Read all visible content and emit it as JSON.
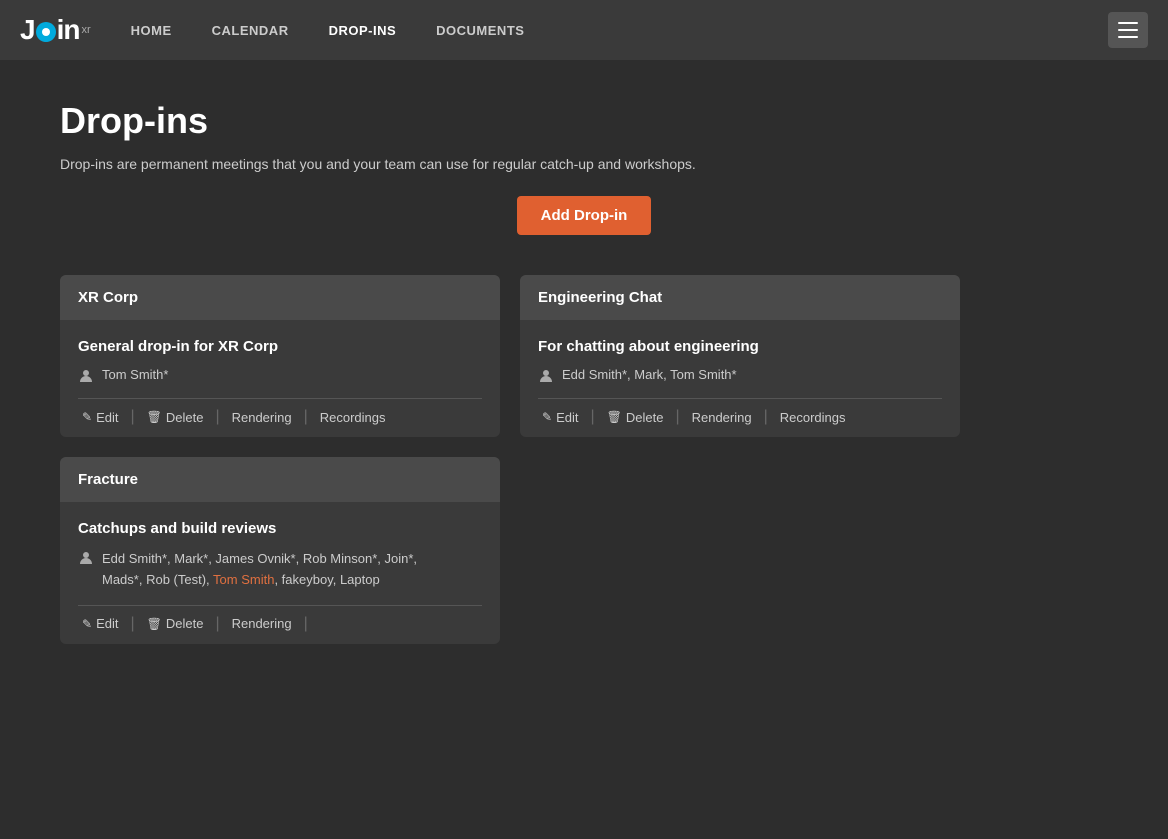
{
  "nav": {
    "logo_text_j": "J",
    "logo_text_in": "in",
    "logo_xr": "xr",
    "links": [
      {
        "label": "HOME",
        "active": false
      },
      {
        "label": "CALENDAR",
        "active": false
      },
      {
        "label": "DROP-INS",
        "active": true
      },
      {
        "label": "DOCUMENTS",
        "active": false
      }
    ]
  },
  "page": {
    "title": "Drop-ins",
    "subtitle": "Drop-ins are permanent meetings that you and your team can use for regular catch-up and workshops.",
    "add_button": "Add Drop-in"
  },
  "cards": [
    {
      "id": "xr-corp",
      "header": "XR Corp",
      "meeting_name": "General drop-in for XR Corp",
      "participants": "Tom Smith*",
      "actions": [
        {
          "label": "Edit",
          "icon": "✏️"
        },
        {
          "label": "Delete",
          "icon": "🗑"
        },
        {
          "label": "Rendering",
          "icon": ""
        },
        {
          "label": "Recordings",
          "icon": ""
        }
      ]
    },
    {
      "id": "engineering-chat",
      "header": "Engineering Chat",
      "meeting_name": "For chatting about engineering",
      "participants": "Edd Smith*, Mark, Tom Smith*",
      "actions": [
        {
          "label": "Edit",
          "icon": "✏️"
        },
        {
          "label": "Delete",
          "icon": "🗑"
        },
        {
          "label": "Rendering",
          "icon": ""
        },
        {
          "label": "Recordings",
          "icon": ""
        }
      ]
    },
    {
      "id": "fracture",
      "header": "Fracture",
      "meeting_name": "Catchups and build reviews",
      "participants_line1": "Edd Smith*, Mark*, James Ovnik*, Rob Minson*, Join*,",
      "participants_line2_plain": "Mads*, Rob (Test),",
      "participants_line2_highlight": " Tom Smith",
      "participants_line2_end": ", fakeyboy, Laptop",
      "actions": [
        {
          "label": "Edit",
          "icon": "✏️"
        },
        {
          "label": "Delete",
          "icon": "🗑"
        },
        {
          "label": "Rendering",
          "icon": ""
        }
      ]
    }
  ],
  "icons": {
    "edit": "✎",
    "delete": "🗑",
    "person": "👤"
  }
}
